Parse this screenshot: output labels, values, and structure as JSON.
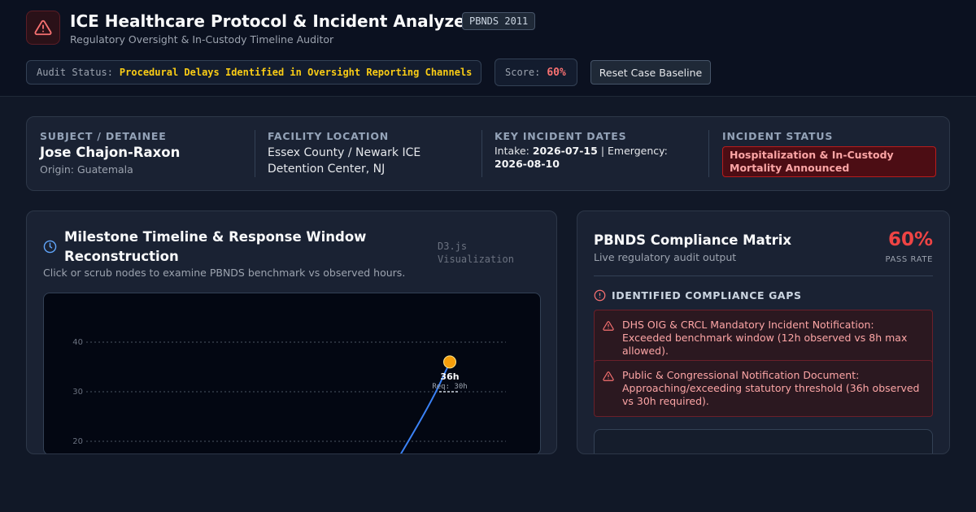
{
  "header": {
    "title": "ICE Healthcare Protocol & Incident Analyzer",
    "badge": "PBNDS 2011",
    "subtitle": "Regulatory Oversight & In-Custody Timeline Auditor",
    "audit_status_label": "Audit Status:",
    "audit_status_value": "Procedural Delays Identified in Oversight Reporting Channels",
    "score_label": "Score:",
    "score_value": "60%",
    "reset_button": "Reset Case Baseline",
    "icon": "alert-triangle-icon"
  },
  "subject": {
    "detainee_label": "SUBJECT / DETAINEE",
    "detainee_name": "Jose Chajon-Raxon",
    "origin": "Origin: Guatemala",
    "facility_label": "FACILITY LOCATION",
    "facility_value": "Essex County / Newark ICE Detention Center, NJ",
    "dates_label": "KEY INCIDENT DATES",
    "intake_label": "Intake:",
    "intake_date": "2026-07-15",
    "separator": "|",
    "emergency_label": "Emergency:",
    "emergency_date": "2026-08-10",
    "status_label": "INCIDENT STATUS",
    "status_value": "Hospitalization & In-Custody Mortality Announced"
  },
  "timeline": {
    "icon": "clock-icon",
    "title": "Milestone Timeline & Response Window Reconstruction",
    "badge": "D3.js Visualization",
    "subtitle": "Click or scrub nodes to examine PBNDS benchmark vs observed hours."
  },
  "chart_data": {
    "type": "line",
    "ylim": [
      0,
      40
    ],
    "yticks": [
      "40",
      "30",
      "20"
    ],
    "grid": true,
    "highlight_point": {
      "value_label": "36h",
      "required_label": "Req: 30h",
      "observed": 36,
      "required": 30
    },
    "colors": {
      "line": "#3b82f6",
      "point": "#f59e0b"
    }
  },
  "compliance": {
    "title": "PBNDS Compliance Matrix",
    "subtitle": "Live regulatory audit output",
    "pass_value": "60%",
    "pass_label": "PASS RATE",
    "gaps_title": "IDENTIFIED COMPLIANCE GAPS",
    "gaps": [
      {
        "text": "DHS OIG & CRCL Mandatory Incident Notification: Exceeded benchmark window (12h observed vs 8h max allowed).",
        "icon": "warning-icon"
      },
      {
        "text": "Public & Congressional Notification Document: Approaching/exceeding statutory threshold (36h observed vs 30h required).",
        "icon": "warning-icon"
      }
    ]
  },
  "colors": {
    "background": "#111827",
    "accent_red": "#ef4444",
    "accent_yellow": "#facc15",
    "panel": "#1a2233"
  }
}
